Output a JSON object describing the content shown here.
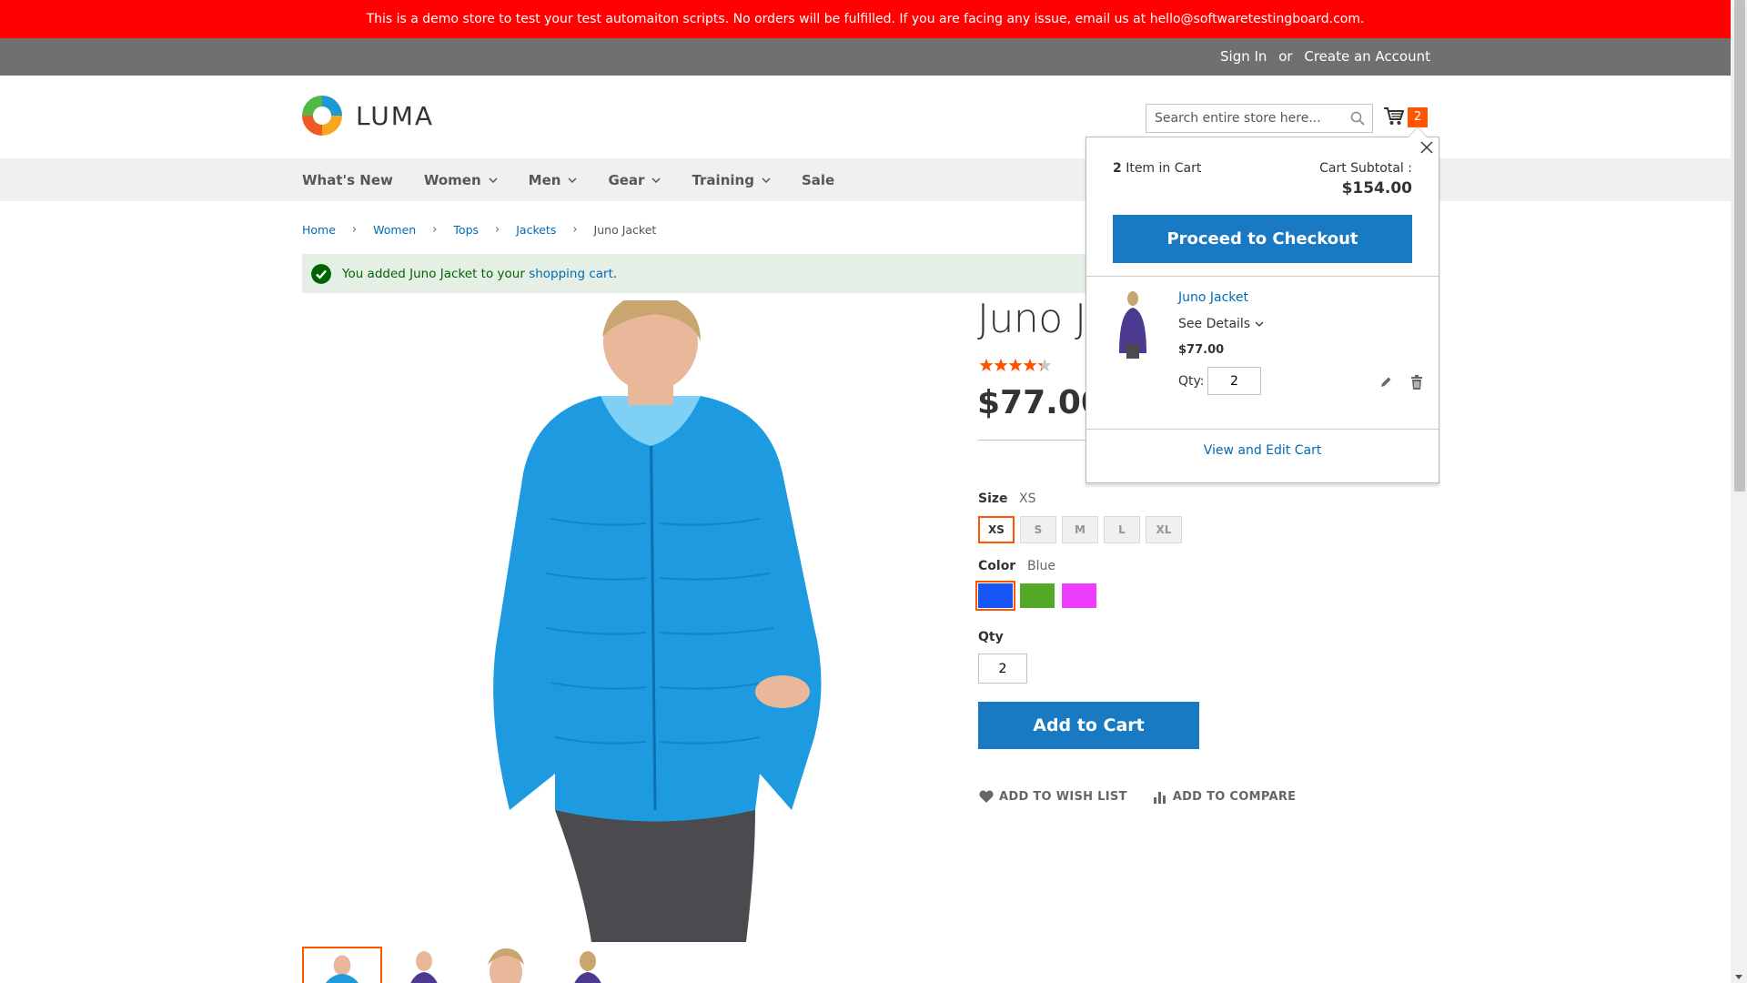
{
  "banner": {
    "text": "This is a demo store to test your test automaiton scripts. No orders will be fulfilled. If you are facing any issue, email us at hello@softwaretestingboard.com."
  },
  "header": {
    "sign_in": "Sign In",
    "or": "or",
    "create_account": "Create an Account",
    "logo_text": "LUMA",
    "search_placeholder": "Search entire store here...",
    "cart_count": "2"
  },
  "nav": {
    "items": [
      {
        "label": "What's New",
        "has_dropdown": false
      },
      {
        "label": "Women",
        "has_dropdown": true
      },
      {
        "label": "Men",
        "has_dropdown": true
      },
      {
        "label": "Gear",
        "has_dropdown": true
      },
      {
        "label": "Training",
        "has_dropdown": true
      },
      {
        "label": "Sale",
        "has_dropdown": false
      }
    ]
  },
  "breadcrumbs": {
    "home": "Home",
    "women": "Women",
    "tops": "Tops",
    "jackets": "Jackets",
    "current": "Juno Jacket"
  },
  "message": {
    "prefix": "You added Juno Jacket to your ",
    "link": "shopping cart",
    "suffix": "."
  },
  "product": {
    "title": "Juno Jacket",
    "price": "$77.00",
    "rating_stars": 4.2,
    "size_label": "Size",
    "size_selected": "XS",
    "sizes": [
      "XS",
      "S",
      "M",
      "L",
      "XL"
    ],
    "color_label": "Color",
    "color_selected": "Blue",
    "colors": [
      {
        "name": "Blue",
        "hex": "#1857f7"
      },
      {
        "name": "Green",
        "hex": "#53a828"
      },
      {
        "name": "Purple",
        "hex": "#ef3dff"
      }
    ],
    "qty_label": "Qty",
    "qty": "2",
    "add_to_cart": "Add to Cart",
    "wishlist": "Add to Wish List",
    "compare": "Add to Compare"
  },
  "minicart": {
    "count": "2",
    "count_suffix": " Item in Cart",
    "subtotal_label": "Cart Subtotal :",
    "subtotal": "$154.00",
    "checkout": "Proceed to Checkout",
    "item_name": "Juno Jacket",
    "see_details": "See Details",
    "item_price": "$77.00",
    "qty_label": "Qty:",
    "qty": "2",
    "view_cart": "View and Edit Cart"
  },
  "colors": {
    "banner": "#ff0101",
    "panel": "#6e716e",
    "accent": "#ff5501",
    "primary": "#1979c3",
    "link": "#006bb4"
  }
}
